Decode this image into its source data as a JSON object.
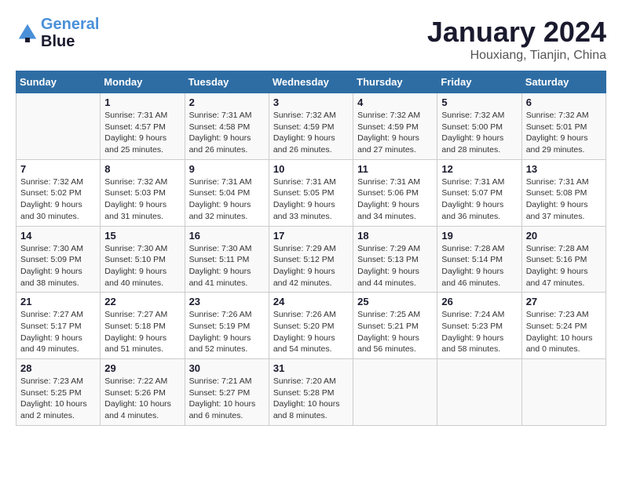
{
  "header": {
    "logo_line1": "General",
    "logo_line2": "Blue",
    "month": "January 2024",
    "location": "Houxiang, Tianjin, China"
  },
  "weekdays": [
    "Sunday",
    "Monday",
    "Tuesday",
    "Wednesday",
    "Thursday",
    "Friday",
    "Saturday"
  ],
  "weeks": [
    [
      {
        "day": "",
        "info": ""
      },
      {
        "day": "1",
        "info": "Sunrise: 7:31 AM\nSunset: 4:57 PM\nDaylight: 9 hours\nand 25 minutes."
      },
      {
        "day": "2",
        "info": "Sunrise: 7:31 AM\nSunset: 4:58 PM\nDaylight: 9 hours\nand 26 minutes."
      },
      {
        "day": "3",
        "info": "Sunrise: 7:32 AM\nSunset: 4:59 PM\nDaylight: 9 hours\nand 26 minutes."
      },
      {
        "day": "4",
        "info": "Sunrise: 7:32 AM\nSunset: 4:59 PM\nDaylight: 9 hours\nand 27 minutes."
      },
      {
        "day": "5",
        "info": "Sunrise: 7:32 AM\nSunset: 5:00 PM\nDaylight: 9 hours\nand 28 minutes."
      },
      {
        "day": "6",
        "info": "Sunrise: 7:32 AM\nSunset: 5:01 PM\nDaylight: 9 hours\nand 29 minutes."
      }
    ],
    [
      {
        "day": "7",
        "info": "Sunrise: 7:32 AM\nSunset: 5:02 PM\nDaylight: 9 hours\nand 30 minutes."
      },
      {
        "day": "8",
        "info": "Sunrise: 7:32 AM\nSunset: 5:03 PM\nDaylight: 9 hours\nand 31 minutes."
      },
      {
        "day": "9",
        "info": "Sunrise: 7:31 AM\nSunset: 5:04 PM\nDaylight: 9 hours\nand 32 minutes."
      },
      {
        "day": "10",
        "info": "Sunrise: 7:31 AM\nSunset: 5:05 PM\nDaylight: 9 hours\nand 33 minutes."
      },
      {
        "day": "11",
        "info": "Sunrise: 7:31 AM\nSunset: 5:06 PM\nDaylight: 9 hours\nand 34 minutes."
      },
      {
        "day": "12",
        "info": "Sunrise: 7:31 AM\nSunset: 5:07 PM\nDaylight: 9 hours\nand 36 minutes."
      },
      {
        "day": "13",
        "info": "Sunrise: 7:31 AM\nSunset: 5:08 PM\nDaylight: 9 hours\nand 37 minutes."
      }
    ],
    [
      {
        "day": "14",
        "info": "Sunrise: 7:30 AM\nSunset: 5:09 PM\nDaylight: 9 hours\nand 38 minutes."
      },
      {
        "day": "15",
        "info": "Sunrise: 7:30 AM\nSunset: 5:10 PM\nDaylight: 9 hours\nand 40 minutes."
      },
      {
        "day": "16",
        "info": "Sunrise: 7:30 AM\nSunset: 5:11 PM\nDaylight: 9 hours\nand 41 minutes."
      },
      {
        "day": "17",
        "info": "Sunrise: 7:29 AM\nSunset: 5:12 PM\nDaylight: 9 hours\nand 42 minutes."
      },
      {
        "day": "18",
        "info": "Sunrise: 7:29 AM\nSunset: 5:13 PM\nDaylight: 9 hours\nand 44 minutes."
      },
      {
        "day": "19",
        "info": "Sunrise: 7:28 AM\nSunset: 5:14 PM\nDaylight: 9 hours\nand 46 minutes."
      },
      {
        "day": "20",
        "info": "Sunrise: 7:28 AM\nSunset: 5:16 PM\nDaylight: 9 hours\nand 47 minutes."
      }
    ],
    [
      {
        "day": "21",
        "info": "Sunrise: 7:27 AM\nSunset: 5:17 PM\nDaylight: 9 hours\nand 49 minutes."
      },
      {
        "day": "22",
        "info": "Sunrise: 7:27 AM\nSunset: 5:18 PM\nDaylight: 9 hours\nand 51 minutes."
      },
      {
        "day": "23",
        "info": "Sunrise: 7:26 AM\nSunset: 5:19 PM\nDaylight: 9 hours\nand 52 minutes."
      },
      {
        "day": "24",
        "info": "Sunrise: 7:26 AM\nSunset: 5:20 PM\nDaylight: 9 hours\nand 54 minutes."
      },
      {
        "day": "25",
        "info": "Sunrise: 7:25 AM\nSunset: 5:21 PM\nDaylight: 9 hours\nand 56 minutes."
      },
      {
        "day": "26",
        "info": "Sunrise: 7:24 AM\nSunset: 5:23 PM\nDaylight: 9 hours\nand 58 minutes."
      },
      {
        "day": "27",
        "info": "Sunrise: 7:23 AM\nSunset: 5:24 PM\nDaylight: 10 hours\nand 0 minutes."
      }
    ],
    [
      {
        "day": "28",
        "info": "Sunrise: 7:23 AM\nSunset: 5:25 PM\nDaylight: 10 hours\nand 2 minutes."
      },
      {
        "day": "29",
        "info": "Sunrise: 7:22 AM\nSunset: 5:26 PM\nDaylight: 10 hours\nand 4 minutes."
      },
      {
        "day": "30",
        "info": "Sunrise: 7:21 AM\nSunset: 5:27 PM\nDaylight: 10 hours\nand 6 minutes."
      },
      {
        "day": "31",
        "info": "Sunrise: 7:20 AM\nSunset: 5:28 PM\nDaylight: 10 hours\nand 8 minutes."
      },
      {
        "day": "",
        "info": ""
      },
      {
        "day": "",
        "info": ""
      },
      {
        "day": "",
        "info": ""
      }
    ]
  ]
}
